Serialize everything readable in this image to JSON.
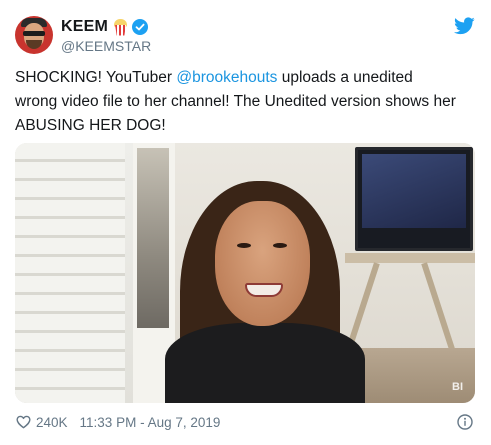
{
  "author": {
    "display_name": "KEEM",
    "handle": "@KEEMSTAR",
    "emoji_icon": "popcorn-icon",
    "verified": true
  },
  "tweet": {
    "line1_before": "SHOCKING! YouTuber ",
    "mention": "@brookehouts",
    "line1_after": " uploads a unedited",
    "line2": "wrong video file to her channel! The Unedited version shows her",
    "line3": "ABUSING HER DOG!"
  },
  "media": {
    "watermark": "BI"
  },
  "footer": {
    "likes": "240K",
    "timestamp": "11:33 PM - Aug 7, 2019"
  },
  "colors": {
    "twitter_blue": "#1da1f2",
    "mention_blue": "#1b95e0",
    "text": "#14171a",
    "muted": "#657786"
  }
}
